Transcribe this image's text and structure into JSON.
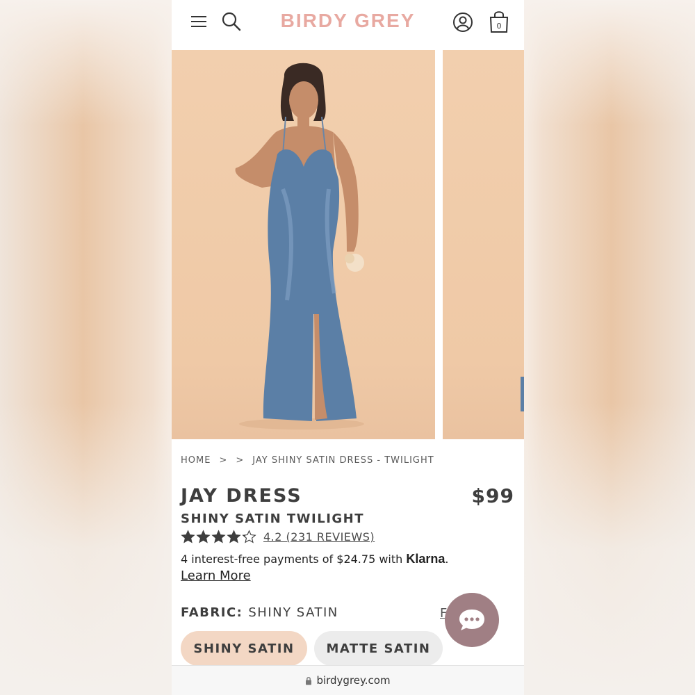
{
  "header": {
    "logo": "BIRDY GREY",
    "cart_count": "0"
  },
  "breadcrumb": {
    "home": "HOME",
    "sep1": ">",
    "sep2": ">",
    "current": "JAY SHINY SATIN DRESS - TWILIGHT"
  },
  "product": {
    "title": "JAY DRESS",
    "price": "$99",
    "subtitle": "SHINY SATIN TWILIGHT",
    "rating": 4.2,
    "reviews_text": "4.2 (231 REVIEWS)",
    "installments_text": "4 interest-free payments of $24.75 with ",
    "klarna_brand": "Klarna",
    "klarna_suffix": ".",
    "learn_more": "Learn More",
    "fabric_label": "FABRIC:",
    "fabric_value": "SHINY SATIN",
    "swatch_code": "F101",
    "fabric_options": [
      "SHINY SATIN",
      "MATTE SATIN"
    ],
    "selected_fabric": "SHINY SATIN",
    "dress_color": "#5b7fa6"
  },
  "browser": {
    "url": "birdygrey.com"
  },
  "colors": {
    "brand": "#e8a9a1",
    "text": "#3e3e3e",
    "selected_pill": "#f3d7c4",
    "unselected_pill": "#ececec",
    "chat": "#a07f84",
    "backdrop": "#efc9a6"
  }
}
